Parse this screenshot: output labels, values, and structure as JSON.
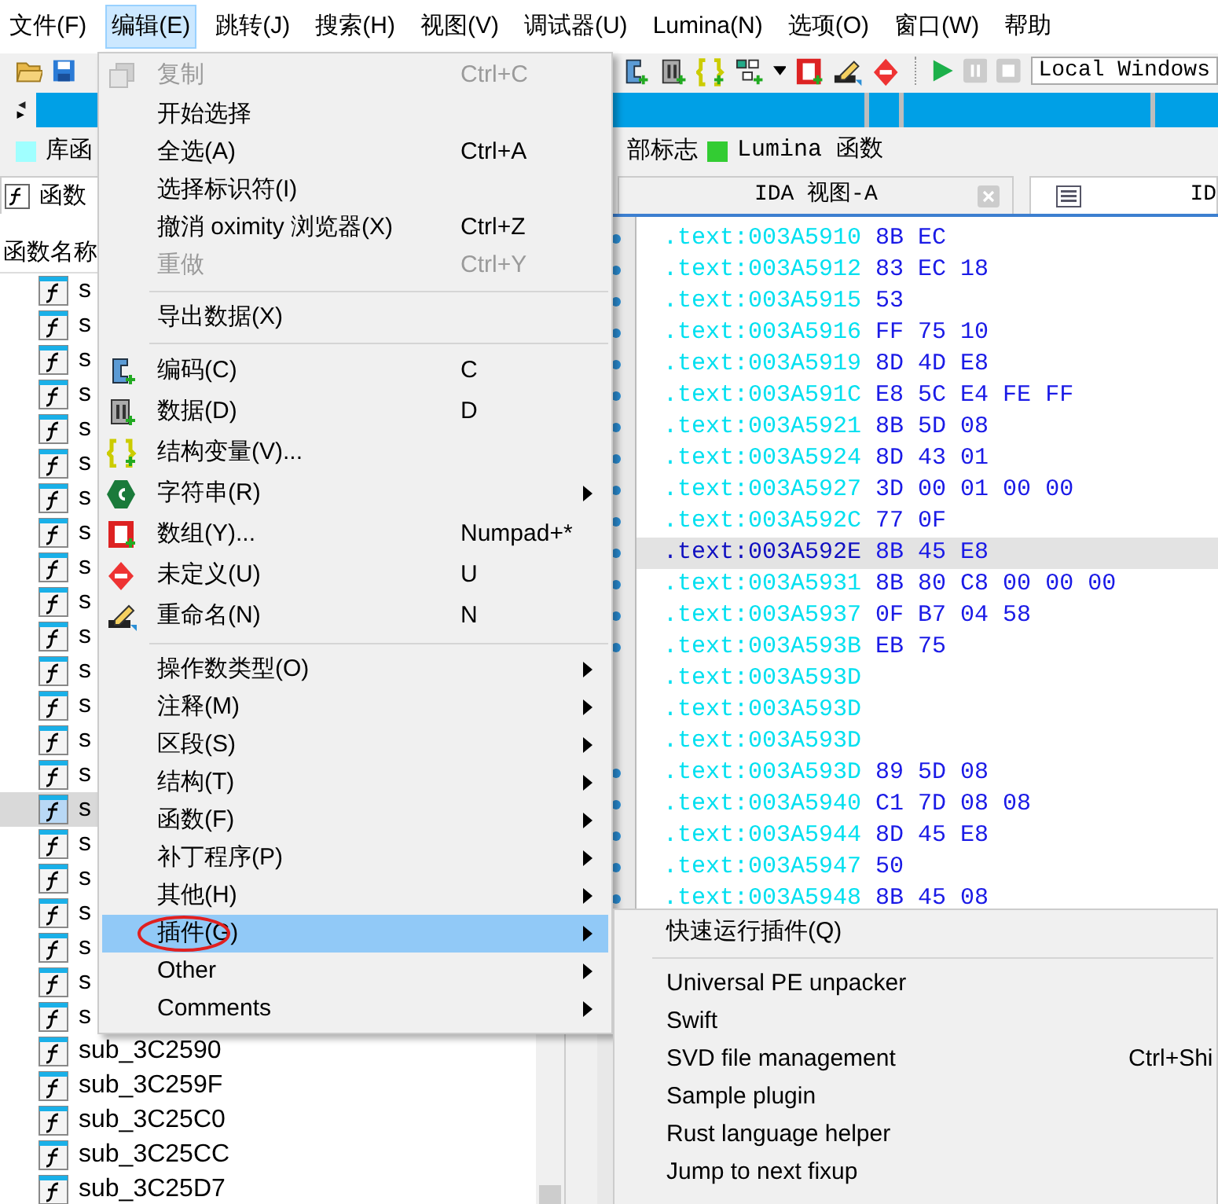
{
  "menubar": [
    {
      "label": "文件(F)",
      "selected": false
    },
    {
      "label": "编辑(E)",
      "selected": true
    },
    {
      "label": "跳转(J)",
      "selected": false
    },
    {
      "label": "搜索(H)",
      "selected": false
    },
    {
      "label": "视图(V)",
      "selected": false
    },
    {
      "label": "调试器(U)",
      "selected": false
    },
    {
      "label": "Lumina(N)",
      "selected": false
    },
    {
      "label": "选项(O)",
      "selected": false
    },
    {
      "label": "窗口(W)",
      "selected": false
    },
    {
      "label": "帮助",
      "selected": false
    }
  ],
  "toolbar": {
    "debugger_combo": "Local Windows"
  },
  "legend": [
    {
      "label": "库函",
      "color": "#a0ffff"
    },
    {
      "label": "部标志"
    },
    {
      "label": "Lumina 函数",
      "color": "#33cc33"
    }
  ],
  "functions_panel": {
    "tab": "函数",
    "header": "函数名称",
    "rows": [
      {
        "name": "s",
        "selected": false
      },
      {
        "name": "s",
        "selected": false
      },
      {
        "name": "s",
        "selected": false
      },
      {
        "name": "s",
        "selected": false
      },
      {
        "name": "s",
        "selected": false
      },
      {
        "name": "s",
        "selected": false
      },
      {
        "name": "s",
        "selected": false
      },
      {
        "name": "s",
        "selected": false
      },
      {
        "name": "s",
        "selected": false
      },
      {
        "name": "s",
        "selected": false
      },
      {
        "name": "s",
        "selected": false
      },
      {
        "name": "s",
        "selected": false
      },
      {
        "name": "s",
        "selected": false
      },
      {
        "name": "s",
        "selected": false
      },
      {
        "name": "s",
        "selected": false
      },
      {
        "name": "s",
        "selected": true
      },
      {
        "name": "s",
        "selected": false
      },
      {
        "name": "s",
        "selected": false
      },
      {
        "name": "s",
        "selected": false
      },
      {
        "name": "s",
        "selected": false
      },
      {
        "name": "s",
        "selected": false
      },
      {
        "name": "s",
        "selected": false
      },
      {
        "name": "sub_3C2590",
        "selected": false
      },
      {
        "name": "sub_3C259F",
        "selected": false
      },
      {
        "name": "sub_3C25C0",
        "selected": false
      },
      {
        "name": "sub_3C25CC",
        "selected": false
      },
      {
        "name": "sub_3C25D7",
        "selected": false
      }
    ]
  },
  "code_view": {
    "tabs": [
      {
        "label": "IDA 视图-A",
        "selected": false
      },
      {
        "label": "ID",
        "selected": true
      }
    ],
    "lines": [
      {
        "address": ".text:003A5910",
        "bytes": "8B EC",
        "selected": false,
        "marker": true
      },
      {
        "address": ".text:003A5912",
        "bytes": "83 EC 18",
        "selected": false,
        "marker": true
      },
      {
        "address": ".text:003A5915",
        "bytes": "53",
        "selected": false,
        "marker": true
      },
      {
        "address": ".text:003A5916",
        "bytes": "FF 75 10",
        "selected": false,
        "marker": true
      },
      {
        "address": ".text:003A5919",
        "bytes": "8D 4D E8",
        "selected": false,
        "marker": true
      },
      {
        "address": ".text:003A591C",
        "bytes": "E8 5C E4 FE FF",
        "selected": false,
        "marker": true
      },
      {
        "address": ".text:003A5921",
        "bytes": "8B 5D 08",
        "selected": false,
        "marker": true
      },
      {
        "address": ".text:003A5924",
        "bytes": "8D 43 01",
        "selected": false,
        "marker": true
      },
      {
        "address": ".text:003A5927",
        "bytes": "3D 00 01 00 00",
        "selected": false,
        "marker": true
      },
      {
        "address": ".text:003A592C",
        "bytes": "77 0F",
        "selected": false,
        "marker": true
      },
      {
        "address": ".text:003A592E",
        "bytes": "8B 45 E8",
        "selected": true,
        "marker": true
      },
      {
        "address": ".text:003A5931",
        "bytes": "8B 80 C8 00 00 00",
        "selected": false,
        "marker": true
      },
      {
        "address": ".text:003A5937",
        "bytes": "0F B7 04 58",
        "selected": false,
        "marker": true
      },
      {
        "address": ".text:003A593B",
        "bytes": "EB 75",
        "selected": false,
        "marker": true
      },
      {
        "address": ".text:003A593D",
        "selected": false,
        "marker": false
      },
      {
        "address": ".text:003A593D",
        "selected": false,
        "marker": false
      },
      {
        "address": ".text:003A593D",
        "selected": false,
        "marker": false
      },
      {
        "address": ".text:003A593D",
        "bytes": "89 5D 08",
        "selected": false,
        "marker": true
      },
      {
        "address": ".text:003A5940",
        "bytes": "C1 7D 08 08",
        "selected": false,
        "marker": true
      },
      {
        "address": ".text:003A5944",
        "bytes": "8D 45 E8",
        "selected": false,
        "marker": true
      },
      {
        "address": ".text:003A5947",
        "bytes": "50",
        "selected": false,
        "marker": true
      },
      {
        "address": ".text:003A5948",
        "bytes": "8B 45 08",
        "selected": false,
        "marker": true
      }
    ]
  },
  "edit_menu": {
    "items": [
      {
        "kind": "item",
        "label": "复制",
        "shortcut": "Ctrl+C",
        "disabled": true,
        "selected": false,
        "submenu": false,
        "circled": false
      },
      {
        "kind": "item",
        "label": "开始选择",
        "disabled": false,
        "selected": false,
        "submenu": false,
        "circled": false
      },
      {
        "kind": "item",
        "label": "全选(A)",
        "shortcut": "Ctrl+A",
        "disabled": false,
        "selected": false,
        "submenu": false,
        "circled": false
      },
      {
        "kind": "item",
        "label": "选择标识符(I)",
        "disabled": false,
        "selected": false,
        "submenu": false,
        "circled": false
      },
      {
        "kind": "item",
        "label": "撤消 oximity 浏览器(X)",
        "shortcut": "Ctrl+Z",
        "disabled": false,
        "selected": false,
        "submenu": false,
        "circled": false
      },
      {
        "kind": "item",
        "label": "重做",
        "shortcut": "Ctrl+Y",
        "disabled": true,
        "selected": false,
        "submenu": false,
        "circled": false
      },
      {
        "kind": "separator"
      },
      {
        "kind": "item",
        "label": "导出数据(X)",
        "disabled": false,
        "selected": false,
        "submenu": false,
        "circled": false
      },
      {
        "kind": "separator"
      },
      {
        "kind": "item",
        "label": "编码(C)",
        "shortcut": "C",
        "disabled": false,
        "selected": false,
        "submenu": false,
        "circled": false
      },
      {
        "kind": "item",
        "label": "数据(D)",
        "shortcut": "D",
        "disabled": false,
        "selected": false,
        "submenu": false,
        "circled": false
      },
      {
        "kind": "item",
        "label": "结构变量(V)...",
        "disabled": false,
        "selected": false,
        "submenu": false,
        "circled": false
      },
      {
        "kind": "item",
        "label": "字符串(R)",
        "disabled": false,
        "selected": false,
        "submenu": true,
        "circled": false
      },
      {
        "kind": "item",
        "label": "数组(Y)...",
        "shortcut": "Numpad+*",
        "disabled": false,
        "selected": false,
        "submenu": false,
        "circled": false
      },
      {
        "kind": "item",
        "label": "未定义(U)",
        "shortcut": "U",
        "disabled": false,
        "selected": false,
        "submenu": false,
        "circled": false
      },
      {
        "kind": "item",
        "label": "重命名(N)",
        "shortcut": "N",
        "disabled": false,
        "selected": false,
        "submenu": false,
        "circled": false
      },
      {
        "kind": "separator"
      },
      {
        "kind": "item",
        "label": "操作数类型(O)",
        "disabled": false,
        "selected": false,
        "submenu": true,
        "circled": false
      },
      {
        "kind": "item",
        "label": "注释(M)",
        "disabled": false,
        "selected": false,
        "submenu": true,
        "circled": false
      },
      {
        "kind": "item",
        "label": "区段(S)",
        "disabled": false,
        "selected": false,
        "submenu": true,
        "circled": false
      },
      {
        "kind": "item",
        "label": "结构(T)",
        "disabled": false,
        "selected": false,
        "submenu": true,
        "circled": false
      },
      {
        "kind": "item",
        "label": "函数(F)",
        "disabled": false,
        "selected": false,
        "submenu": true,
        "circled": false
      },
      {
        "kind": "item",
        "label": "补丁程序(P)",
        "disabled": false,
        "selected": false,
        "submenu": true,
        "circled": false
      },
      {
        "kind": "item",
        "label": "其他(H)",
        "disabled": false,
        "selected": false,
        "submenu": true,
        "circled": false
      },
      {
        "kind": "item",
        "label": "插件(G)",
        "disabled": false,
        "selected": true,
        "submenu": true,
        "circled": true
      },
      {
        "kind": "item",
        "label": "Other",
        "disabled": false,
        "selected": false,
        "submenu": true,
        "circled": false
      },
      {
        "kind": "item",
        "label": "Comments",
        "disabled": false,
        "selected": false,
        "submenu": true,
        "circled": false
      }
    ]
  },
  "plugins_submenu": {
    "items": [
      {
        "kind": "item",
        "label": "快速运行插件(Q)"
      },
      {
        "kind": "separator"
      },
      {
        "kind": "item",
        "label": "Universal PE unpacker"
      },
      {
        "kind": "item",
        "label": "Swift"
      },
      {
        "kind": "item",
        "label": "SVD file management",
        "shortcut": "Ctrl+Shi"
      },
      {
        "kind": "item",
        "label": "Sample plugin"
      },
      {
        "kind": "item",
        "label": "Rust language helper"
      },
      {
        "kind": "item",
        "label": "Jump to next fixup"
      }
    ]
  }
}
